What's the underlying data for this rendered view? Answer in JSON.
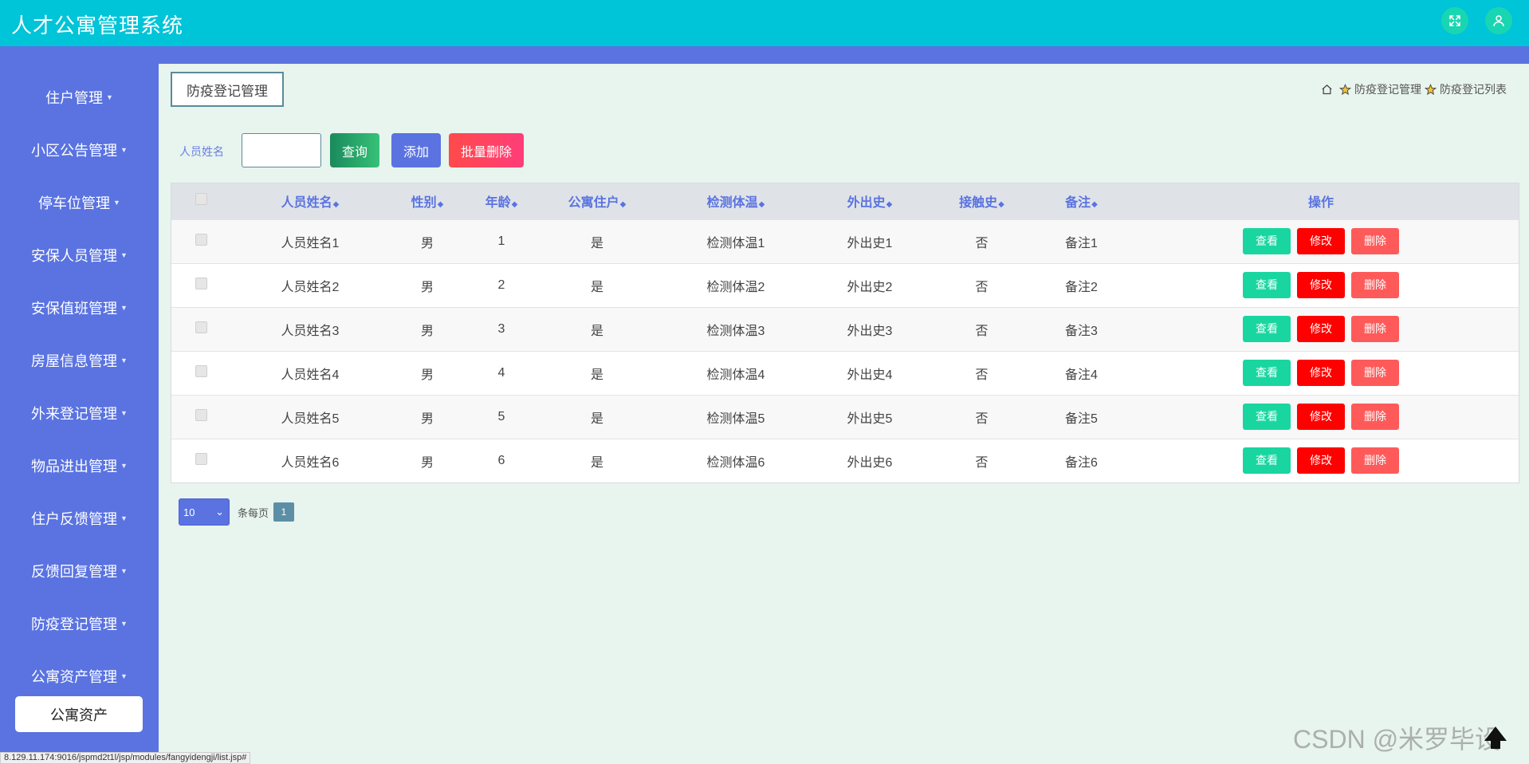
{
  "app": {
    "title": "人才公寓管理系统"
  },
  "sidebar": {
    "items": [
      {
        "label": "住户管理"
      },
      {
        "label": "小区公告管理"
      },
      {
        "label": "停车位管理"
      },
      {
        "label": "安保人员管理"
      },
      {
        "label": "安保值班管理"
      },
      {
        "label": "房屋信息管理"
      },
      {
        "label": "外来登记管理"
      },
      {
        "label": "物品进出管理"
      },
      {
        "label": "住户反馈管理"
      },
      {
        "label": "反馈回复管理"
      },
      {
        "label": "防疫登记管理"
      },
      {
        "label": "公寓资产管理"
      }
    ],
    "active_label": "公寓资产"
  },
  "page": {
    "title_button": "防疫登记管理",
    "breadcrumb": [
      "防疫登记管理",
      "防疫登记列表"
    ]
  },
  "search": {
    "label": "人员姓名",
    "value": "",
    "query_label": "查询",
    "add_label": "添加",
    "bulk_delete_label": "批量删除"
  },
  "table": {
    "columns": [
      "人员姓名",
      "性别",
      "年龄",
      "公寓住户",
      "检测体温",
      "外出史",
      "接触史",
      "备注",
      "操作"
    ],
    "actions": {
      "view": "查看",
      "edit": "修改",
      "delete": "删除"
    },
    "rows": [
      [
        "人员姓名1",
        "男",
        "1",
        "是",
        "检测体温1",
        "外出史1",
        "否",
        "备注1"
      ],
      [
        "人员姓名2",
        "男",
        "2",
        "是",
        "检测体温2",
        "外出史2",
        "否",
        "备注2"
      ],
      [
        "人员姓名3",
        "男",
        "3",
        "是",
        "检测体温3",
        "外出史3",
        "否",
        "备注3"
      ],
      [
        "人员姓名4",
        "男",
        "4",
        "是",
        "检测体温4",
        "外出史4",
        "否",
        "备注4"
      ],
      [
        "人员姓名5",
        "男",
        "5",
        "是",
        "检测体温5",
        "外出史5",
        "否",
        "备注5"
      ],
      [
        "人员姓名6",
        "男",
        "6",
        "是",
        "检测体温6",
        "外出史6",
        "否",
        "备注6"
      ]
    ]
  },
  "pagination": {
    "page_size": "10",
    "per_page_label": "条每页",
    "current_page": "1"
  },
  "status_bar": {
    "url": "8.129.11.174:9016/jspmd2t1l/jsp/modules/fangyidengji/list.jsp#"
  },
  "watermark": {
    "text": "CSDN @米罗毕设"
  },
  "colors": {
    "topbar": "#00c4d8",
    "sidebar": "#5a73e1",
    "accent": "#5a73e1",
    "view": "#19d6a0",
    "edit": "#ff0000",
    "delete": "#ff5a5a"
  },
  "icons": {
    "fullscreen": "expand-icon",
    "user": "user-icon",
    "home": "home-icon",
    "breadcrumb_separator": "star-icon",
    "back_to_top": "arrow-up-icon"
  }
}
